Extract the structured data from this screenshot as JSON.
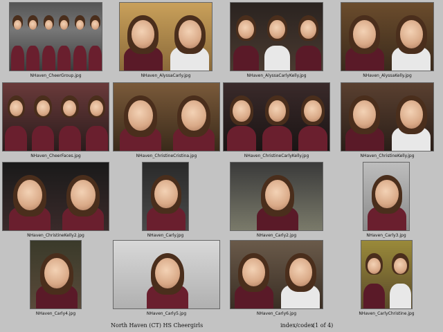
{
  "gallery": {
    "title": "North Haven (CT) HS Cheergirls",
    "index_label": "index/codex",
    "page_info": "(1 of 4)",
    "thumbnails": [
      {
        "filename": "NHaven_CheerGroup.jpg"
      },
      {
        "filename": "NHaven_AlyssaCarly.jpg"
      },
      {
        "filename": "NHaven_AlyssaCarlyKelly.jpg"
      },
      {
        "filename": "NHaven_AlyssaKelly.jpg"
      },
      {
        "filename": "NHaven_CheerFaces.jpg"
      },
      {
        "filename": "NHaven_ChristineCristina.jpg"
      },
      {
        "filename": "NHaven_ChristineCarlyKelly.jpg"
      },
      {
        "filename": "NHaven_ChristineKelly.jpg"
      },
      {
        "filename": "NHaven_ChristineKelly2.jpg"
      },
      {
        "filename": "NHaven_Carly.jpg"
      },
      {
        "filename": "NHaven_Carly2.jpg"
      },
      {
        "filename": "NHaven_Carly3.jpg"
      },
      {
        "filename": "NHaven_Carly4.jpg"
      },
      {
        "filename": "NHaven_Carly5.jpg"
      },
      {
        "filename": "NHaven_Carly6.jpg"
      },
      {
        "filename": "NHaven_CarlyChristine.jpg"
      }
    ]
  },
  "colors": {
    "background": "#c3c3c3",
    "maroon": "#6a1f2e"
  }
}
